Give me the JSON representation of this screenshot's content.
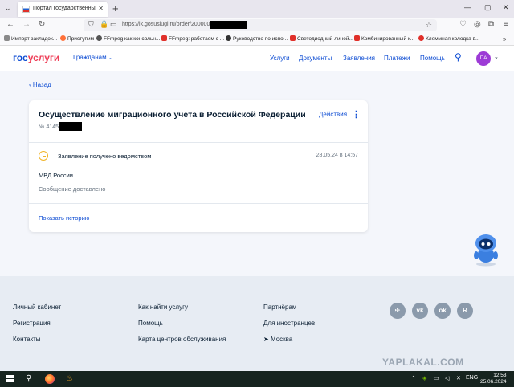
{
  "browser": {
    "tab_title": "Портал государственных услуг",
    "tab_close": "✕",
    "new_tab": "+",
    "url": "https://lk.gosuslugi.ru/order/200000",
    "window_min": "—",
    "window_max": "▢",
    "window_close": "✕",
    "bookmarks": [
      {
        "label": "Импорт закладок...",
        "color": "#8a8a8a"
      },
      {
        "label": "Приступим",
        "color": "#ff7139"
      },
      {
        "label": "FFmpeg как консольн...",
        "color": "#555555"
      },
      {
        "label": "FFmpeg: работаем с ...",
        "color": "#e0302a"
      },
      {
        "label": "Руководство по испо...",
        "color": "#333333"
      },
      {
        "label": "Светодиодный линей...",
        "color": "#e0302a"
      },
      {
        "label": "Комбинированный к...",
        "color": "#e0302a"
      },
      {
        "label": "Клеммная колодка в...",
        "color": "#e0302a"
      }
    ]
  },
  "header": {
    "logo_part1": "гос",
    "logo_part2": "услуги",
    "citizens": "Гражданам",
    "menu": [
      "Услуги",
      "Документы",
      "Заявления",
      "Платежи",
      "Помощь"
    ],
    "avatar_initials": "ПА"
  },
  "main": {
    "back_label": "Назад",
    "card": {
      "title": "Осуществление миграционного учета в Российской Федерации",
      "number_prefix": "№ 4145",
      "actions_label": "Действия",
      "status": "Заявление получено ведомством",
      "status_date": "28.05.24 в 14:57",
      "department": "МВД России",
      "message": "Сообщение доставлено",
      "history_label": "Показать историю"
    }
  },
  "footer": {
    "col1": [
      "Личный кабинет",
      "Регистрация",
      "Контакты"
    ],
    "col2": [
      "Как найти услугу",
      "Помощь",
      "Карта центров обслуживания"
    ],
    "col3": [
      "Партнёрам",
      "Для иностранцев",
      "Москва"
    ],
    "social": [
      "✈",
      "vk",
      "ok",
      "R"
    ],
    "watermark": "YAPLAKAL.COM"
  },
  "taskbar": {
    "lang": "ENG",
    "time": "12:53",
    "date": "25.06.2024"
  },
  "colors": {
    "accent": "#0d4cd3",
    "brand_red": "#ee3f58",
    "pending": "#f0b429"
  }
}
